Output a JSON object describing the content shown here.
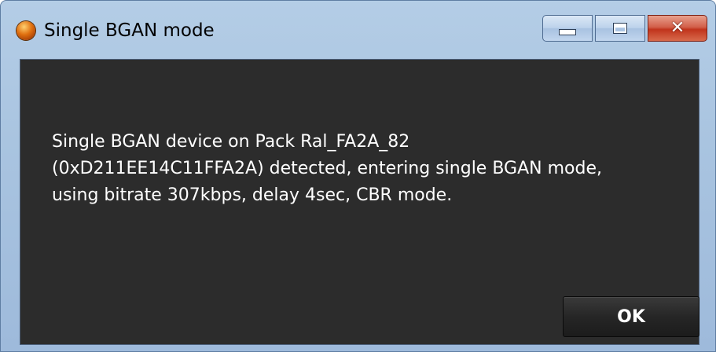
{
  "window": {
    "title": "Single BGAN mode",
    "icon": "app-orb-icon",
    "caption_buttons": [
      "minimize-icon",
      "maximize-icon",
      "close-icon"
    ]
  },
  "dialog": {
    "message_lines": [
      "Single BGAN device on Pack Ral_FA2A_82",
      "(0xD211EE14C11FFA2A) detected, entering single BGAN mode,",
      "using bitrate 307kbps, delay 4sec, CBR mode."
    ],
    "ok_label": "OK"
  },
  "colors": {
    "client_background": "#2c2c2c",
    "text": "#ffffff",
    "close_button": "#c1341c",
    "title_bar": "#a9c4e0"
  }
}
